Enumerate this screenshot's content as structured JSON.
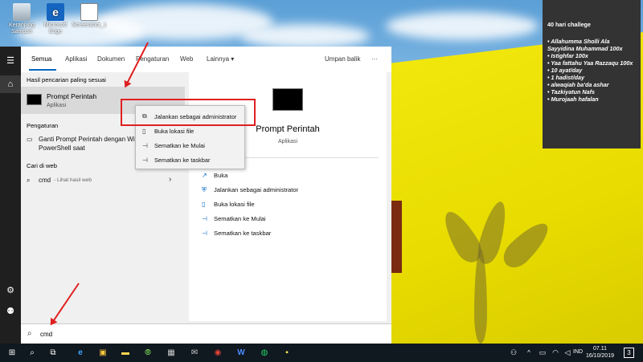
{
  "desktop": {
    "icons": [
      {
        "label": "Keranjang\nSampah",
        "icon": "recycle-bin-icon"
      },
      {
        "label": "Microsoft\nEdge",
        "icon": "edge-icon"
      },
      {
        "label": "Screenshot_1",
        "icon": "image-file-icon"
      }
    ]
  },
  "sticky": {
    "title": "40 hari challege",
    "items": [
      "•  Allahumma Sholli Ala Sayyidina Muhammad 100x",
      "•  Istighfar 100x",
      "•  Yaa fattahu Yaa Razzaqu 100x",
      "•  10 ayat/day",
      "•  1 hadist/day",
      "•  alwaqiah ba'da ashar",
      "•  Tazkiyatun Nafs",
      "•  Murojaah hafalan"
    ]
  },
  "tabs": {
    "all": "Semua",
    "apps": "Aplikasi",
    "docs": "Dokumen",
    "settings": "Pengaturan",
    "web": "Web",
    "more": "Lainnya",
    "feedback": "Umpan balik",
    "options": "···"
  },
  "results": {
    "best_title": "Hasil pencarian paling sesuai",
    "best_name": "Prompt Perintah",
    "best_sub": "Aplikasi",
    "settings_title": "Pengaturan",
    "settings_item": "Ganti Prompt Perintah dengan Windows PowerShell saat",
    "web_title": "Cari di web",
    "web_query": "cmd",
    "web_suffix": "- Lihat hasil web"
  },
  "detail": {
    "name": "Prompt Perintah",
    "sub": "Aplikasi",
    "actions": [
      "Buka",
      "Jalankan sebagai administrator",
      "Buka lokasi file",
      "Sematkan ke Mulai",
      "Sematkan ke taskbar"
    ]
  },
  "context_menu": {
    "items": [
      "Jalankan sebagai administrator",
      "Buka lokasi file",
      "Sematkan ke Mulai",
      "Sematkan ke taskbar"
    ]
  },
  "search": {
    "value": "cmd"
  },
  "taskbar": {
    "lang": "IND",
    "time": "07.11",
    "date": "16/10/2019",
    "notif_count": "3"
  },
  "colors": {
    "accent": "#0067c0",
    "highlight": "#e02020"
  }
}
